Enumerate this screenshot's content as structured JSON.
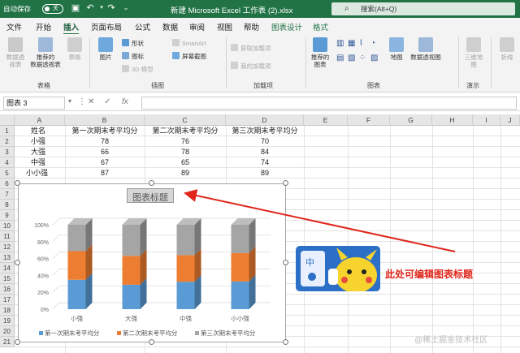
{
  "titlebar": {
    "autosave_label": "自动保存",
    "autosave_state": "关",
    "doc_title": "新建 Microsoft Excel 工作表 (2).xlsx",
    "search_placeholder": "搜索(Alt+Q)"
  },
  "tabs": [
    {
      "label": "文件"
    },
    {
      "label": "开始"
    },
    {
      "label": "插入"
    },
    {
      "label": "页面布局"
    },
    {
      "label": "公式"
    },
    {
      "label": "数据"
    },
    {
      "label": "审阅"
    },
    {
      "label": "视图"
    },
    {
      "label": "帮助"
    },
    {
      "label": "图表设计"
    },
    {
      "label": "格式"
    }
  ],
  "ribbon": {
    "pivot_line1": "数据透",
    "pivot_line2": "视表",
    "rec_pivot_line1": "推荐的",
    "rec_pivot_line2": "数据透视表",
    "table": "表格",
    "picture": "图片",
    "shapes": "形状",
    "icons": "图标",
    "models3d": "3D 模型",
    "smartart": "SmartArt",
    "screenshot": "屏幕截图",
    "get_addins": "获取加载项",
    "my_addins": "我的加载项",
    "rec_charts_line1": "推荐的",
    "rec_charts_line2": "图表",
    "maps": "地图",
    "pivot_chart": "数据透视图",
    "map3d_line1": "三维地",
    "map3d_line2": "图",
    "sparkline": "折线",
    "groups": {
      "tables": "表格",
      "illustrations": "插图",
      "addins": "加载项",
      "charts": "图表",
      "tours": "演示"
    }
  },
  "formula_bar": {
    "name_box": "图表 3",
    "cancel": "✕",
    "enter": "✓",
    "fx": "fx"
  },
  "sheet": {
    "columns": [
      "A",
      "B",
      "C",
      "D",
      "E",
      "F",
      "G",
      "H",
      "I",
      "J"
    ],
    "rows": [
      "1",
      "2",
      "3",
      "4",
      "5",
      "6",
      "7",
      "8",
      "9",
      "10",
      "11",
      "12",
      "13",
      "14",
      "15",
      "16",
      "17",
      "18",
      "19",
      "20",
      "21"
    ],
    "cells": {
      "a1": "姓名",
      "b1": "第一次期末考平均分",
      "c1": "第二次期末考平均分",
      "d1": "第三次期末考平均分",
      "a2": "小强",
      "b2": "78",
      "c2": "76",
      "d2": "70",
      "a3": "大强",
      "b3": "66",
      "c3": "78",
      "d3": "84",
      "a4": "中强",
      "b4": "67",
      "c4": "65",
      "d4": "74",
      "a5": "小小强",
      "b5": "87",
      "c5": "89",
      "d5": "89"
    }
  },
  "chart_data": {
    "type": "bar",
    "subtype": "3d-stacked-100-percent-column",
    "title": "图表标题",
    "categories": [
      "小强",
      "大强",
      "中强",
      "小小强"
    ],
    "series": [
      {
        "name": "第一次期末考平均分",
        "values": [
          78,
          66,
          67,
          87
        ],
        "color": "#5b9bd5"
      },
      {
        "name": "第二次期末考平均分",
        "values": [
          76,
          78,
          65,
          89
        ],
        "color": "#ed7d31"
      },
      {
        "name": "第三次期末考平均分",
        "values": [
          70,
          84,
          74,
          89
        ],
        "color": "#a5a5a5"
      }
    ],
    "yticks": [
      "0%",
      "20%",
      "40%",
      "60%",
      "80%",
      "100%"
    ],
    "ylim": [
      0,
      100
    ],
    "grid": true,
    "legend_position": "bottom"
  },
  "annotation": {
    "text": "此处可编辑图表标题",
    "color": "#e0261b"
  },
  "watermark": "@稀土掘金技术社区",
  "colors": {
    "excel_green": "#217346",
    "accent_red": "#e0261b"
  }
}
